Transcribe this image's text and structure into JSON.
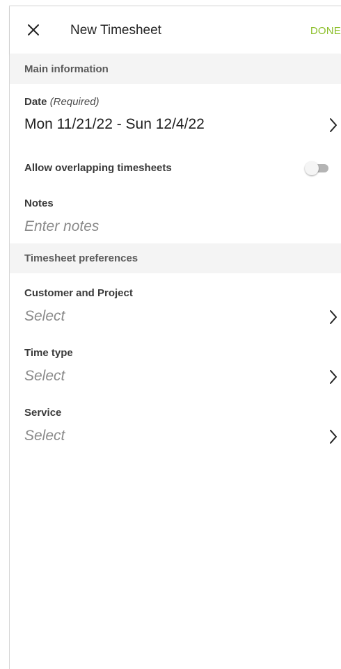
{
  "appbar": {
    "title": "New Timesheet",
    "done_label": "DONE",
    "close_icon": "close-icon"
  },
  "colors": {
    "accent": "#8cbf2a",
    "section_bg": "#f4f4f4"
  },
  "sections": {
    "main_information": "Main information",
    "timesheet_preferences": "Timesheet preferences"
  },
  "date": {
    "label": "Date",
    "required": "(Required)",
    "value": "Mon 11/21/22 - Sun 12/4/22"
  },
  "overlap": {
    "label": "Allow overlapping timesheets",
    "enabled": false
  },
  "notes": {
    "label": "Notes",
    "placeholder": "Enter notes"
  },
  "customer_project": {
    "label": "Customer and Project",
    "placeholder": "Select"
  },
  "time_type": {
    "label": "Time type",
    "placeholder": "Select"
  },
  "service": {
    "label": "Service",
    "placeholder": "Select"
  }
}
